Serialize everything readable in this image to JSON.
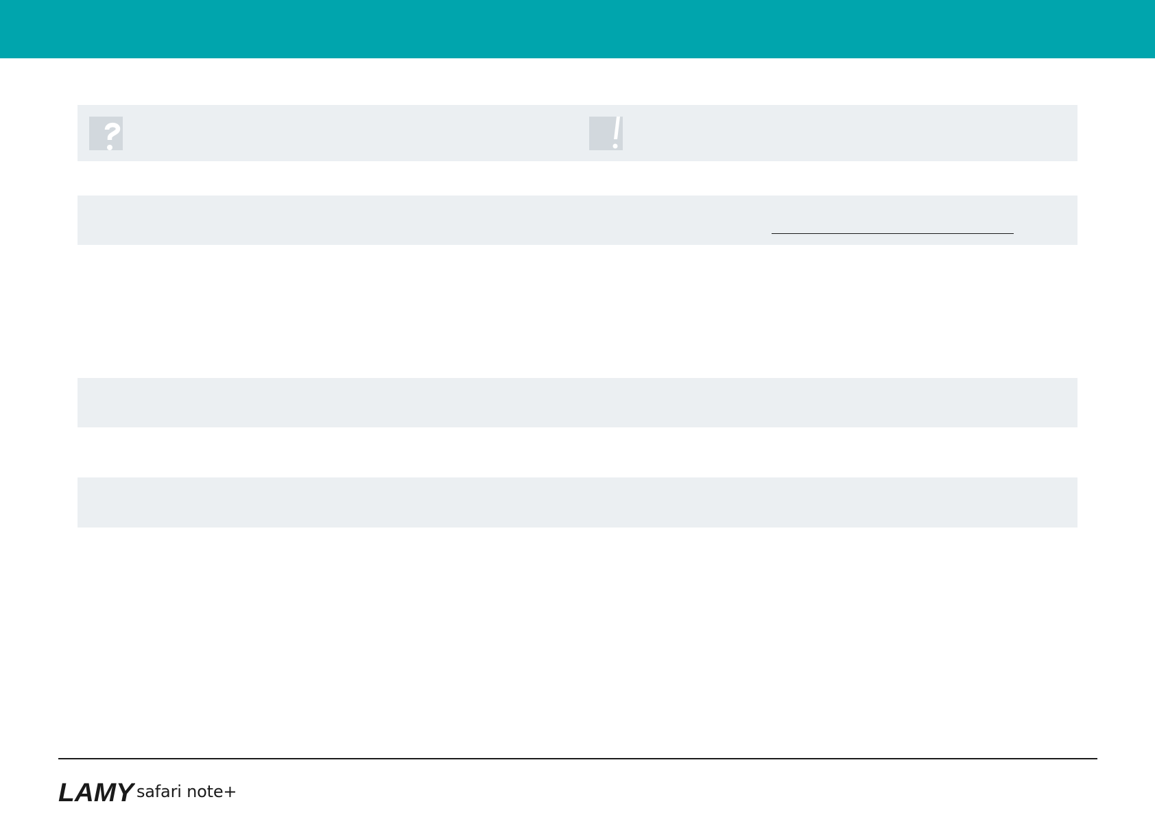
{
  "colors": {
    "header": "#00a5ad",
    "panel": "#ebeff2",
    "icon_box": "#d2d8dd",
    "text": "#1a1a1a"
  },
  "icons": {
    "question": "question-mark-icon",
    "exclamation": "exclamation-mark-icon"
  },
  "footer": {
    "brand": "LAMY",
    "product": "safari note+"
  }
}
